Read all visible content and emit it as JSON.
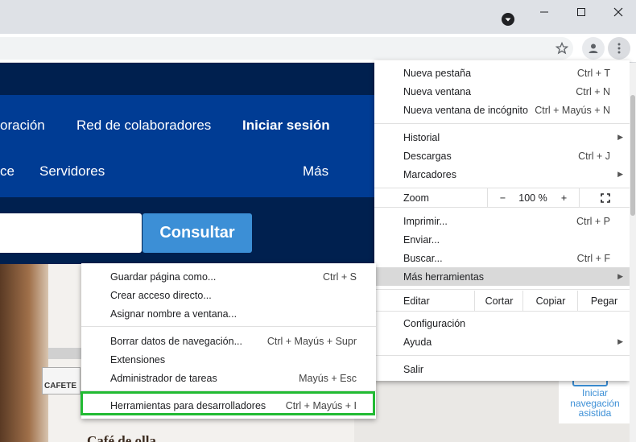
{
  "page": {
    "nav_row1": [
      "oración",
      "Red de colaboradores",
      "Iniciar sesión"
    ],
    "nav_row2": [
      "ce",
      "Servidores",
      "Más"
    ],
    "consult_label": "Consultar",
    "hero": {
      "cafe_text": "Café de olla",
      "cafeteria_text": "CAFETE",
      "assist_text": [
        "Iniciar",
        "navegación",
        "asistida"
      ]
    }
  },
  "chrome_menu": {
    "items": [
      {
        "label": "Nueva pestaña",
        "shortcut": "Ctrl + T"
      },
      {
        "label": "Nueva ventana",
        "shortcut": "Ctrl + N"
      },
      {
        "label": "Nueva ventana de incógnito",
        "shortcut": "Ctrl + Mayús + N"
      },
      {
        "label": "Historial",
        "shortcut": ""
      },
      {
        "label": "Descargas",
        "shortcut": "Ctrl + J"
      },
      {
        "label": "Marcadores",
        "shortcut": ""
      },
      {
        "label": "Imprimir...",
        "shortcut": "Ctrl + P"
      },
      {
        "label": "Enviar...",
        "shortcut": ""
      },
      {
        "label": "Buscar...",
        "shortcut": "Ctrl + F"
      },
      {
        "label": "Más herramientas",
        "shortcut": ""
      },
      {
        "label": "Configuración",
        "shortcut": ""
      },
      {
        "label": "Ayuda",
        "shortcut": ""
      },
      {
        "label": "Salir",
        "shortcut": ""
      }
    ],
    "zoom": {
      "label": "Zoom",
      "minus": "−",
      "value": "100 %",
      "plus": "+"
    },
    "edit": {
      "label": "Editar",
      "cut": "Cortar",
      "copy": "Copiar",
      "paste": "Pegar"
    }
  },
  "submenu": {
    "items": [
      {
        "label": "Guardar página como...",
        "shortcut": "Ctrl + S"
      },
      {
        "label": "Crear acceso directo...",
        "shortcut": ""
      },
      {
        "label": "Asignar nombre a ventana...",
        "shortcut": ""
      },
      {
        "label": "Borrar datos de navegación...",
        "shortcut": "Ctrl + Mayús + Supr"
      },
      {
        "label": "Extensiones",
        "shortcut": ""
      },
      {
        "label": "Administrador de tareas",
        "shortcut": "Mayús + Esc"
      },
      {
        "label": "Herramientas para desarrolladores",
        "shortcut": "Ctrl + Mayús + I"
      }
    ]
  },
  "colors": {
    "highlight_box": "#22bb33",
    "page_dark": "#00204f",
    "page_nav": "#003c94",
    "consult": "#3c8fd6"
  }
}
